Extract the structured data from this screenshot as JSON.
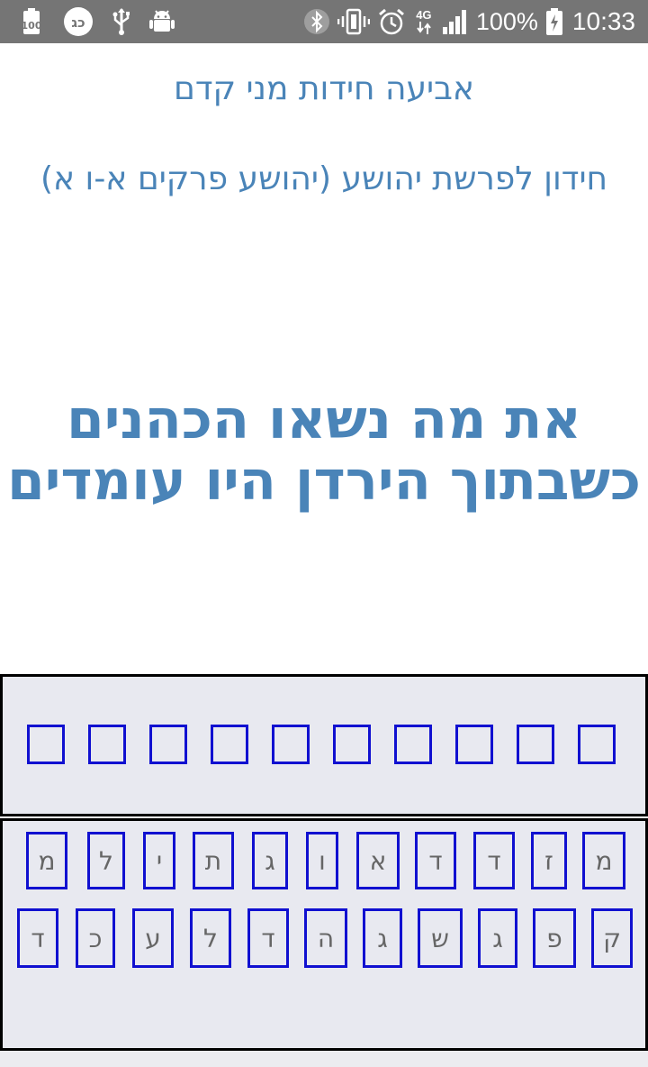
{
  "status_bar": {
    "left_icons": [
      "battery-100-notification-icon",
      "app-notification-icon",
      "usb-icon",
      "android-debug-icon"
    ],
    "right_icons": [
      "bluetooth-icon",
      "vibrate-icon",
      "alarm-icon",
      "network-4g-icon",
      "signal-icon"
    ],
    "network_label": "4G",
    "battery_percent": "100%",
    "time": "10:33"
  },
  "header": {
    "app_title": "אביעה חידות מני קדם",
    "subtitle": "חידון לפרשת יהושע (יהושע פרקים א-ו א)"
  },
  "riddle": {
    "line1": "את מה נשאו הכהנים",
    "line2": "כשבתוך הירדן היו עומדים"
  },
  "answer": {
    "slots": [
      "",
      "",
      "",
      "",
      "",
      "",
      "",
      "",
      "",
      ""
    ]
  },
  "letters": {
    "row1": [
      "מ",
      "ל",
      "י",
      "ת",
      "ג",
      "ו",
      "א",
      "ד",
      "ד",
      "ז",
      "מ"
    ],
    "row2": [
      "ד",
      "כ",
      "ע",
      "ל",
      "ד",
      "ה",
      "ג",
      "ש",
      "ג",
      "פ",
      "ק"
    ]
  },
  "colors": {
    "status_bar": "#757575",
    "title_text": "#4a84b8",
    "slot_border": "#1010d0",
    "panel_bg": "#e8e9f0",
    "letter_text": "#666666"
  }
}
